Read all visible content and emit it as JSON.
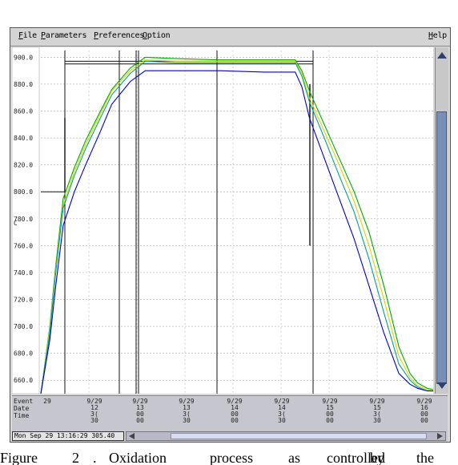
{
  "menu": {
    "file": "File",
    "parameters": "Parameters",
    "preferences": "Preferences",
    "option": "Option",
    "help": "Help"
  },
  "chart_data": {
    "type": "line",
    "ylabel": "C",
    "ylim": [
      650,
      905
    ],
    "y_ticks": [
      "900.0",
      "880.0",
      "860.0",
      "840.0",
      "820.0",
      "800.0",
      "780.0",
      "760.0",
      "740.0",
      "720.0",
      "700.0",
      "680.0",
      "660.0"
    ],
    "xlim": [
      0,
      526
    ],
    "series": [
      {
        "color": "#00a800",
        "x": [
          0,
          12,
          20,
          30,
          45,
          60,
          80,
          95,
          120,
          140,
          180,
          240,
          300,
          330,
          341,
          350,
          360,
          380,
          400,
          420,
          440,
          460,
          480,
          495,
          505,
          518,
          526
        ],
        "values": [
          650,
          700,
          745,
          795,
          818,
          838,
          860,
          876,
          892,
          900,
          899,
          898,
          898,
          898,
          898,
          890,
          875,
          850,
          825,
          800,
          770,
          730,
          685,
          665,
          658,
          654,
          653
        ]
      },
      {
        "color": "#e0d000",
        "x": [
          0,
          12,
          20,
          30,
          45,
          60,
          80,
          95,
          120,
          140,
          180,
          240,
          300,
          330,
          341,
          350,
          360,
          380,
          400,
          420,
          440,
          460,
          480,
          495,
          505,
          518,
          526
        ],
        "values": [
          650,
          698,
          742,
          790,
          815,
          835,
          858,
          875,
          890,
          898,
          897,
          897,
          897,
          897,
          897,
          888,
          870,
          845,
          820,
          793,
          760,
          720,
          678,
          662,
          656,
          653,
          652
        ]
      },
      {
        "color": "#00a0a0",
        "x": [
          0,
          12,
          20,
          30,
          45,
          60,
          80,
          95,
          120,
          140,
          180,
          240,
          300,
          330,
          341,
          350,
          360,
          380,
          400,
          420,
          440,
          460,
          480,
          495,
          505,
          518,
          526
        ],
        "values": [
          650,
          695,
          740,
          788,
          812,
          832,
          855,
          872,
          888,
          897,
          896,
          896,
          896,
          896,
          896,
          886,
          867,
          840,
          812,
          785,
          750,
          710,
          672,
          660,
          655,
          652,
          652
        ]
      },
      {
        "color": "#0000c8",
        "x": [
          0,
          12,
          20,
          30,
          45,
          60,
          80,
          95,
          120,
          140,
          180,
          240,
          300,
          330,
          341,
          350,
          360,
          380,
          400,
          420,
          440,
          460,
          480,
          495,
          505,
          518,
          526
        ],
        "values": [
          650,
          690,
          730,
          775,
          800,
          820,
          845,
          865,
          882,
          890,
          890,
          890,
          889,
          889,
          889,
          878,
          855,
          825,
          795,
          765,
          730,
          695,
          665,
          657,
          654,
          652,
          652
        ]
      }
    ]
  },
  "events": {
    "labels": [
      "Event",
      "Date",
      "Time"
    ],
    "columns": [
      {
        "lines": [
          "29",
          "",
          ""
        ]
      },
      {
        "lines": [
          "9/29",
          "12",
          "3(",
          "30"
        ]
      },
      {
        "lines": [
          "9/29",
          "13",
          "00",
          "00"
        ]
      },
      {
        "lines": [
          "9/29",
          "13",
          "3(",
          "30"
        ]
      },
      {
        "lines": [
          "9/29",
          "14",
          "00",
          "00"
        ]
      },
      {
        "lines": [
          "9/29",
          "14",
          "3(",
          "30"
        ]
      },
      {
        "lines": [
          "9/29",
          "15",
          "00",
          "00"
        ]
      },
      {
        "lines": [
          "9/29",
          "15",
          "3(",
          "30"
        ]
      },
      {
        "lines": [
          "9/29",
          "16",
          "00",
          "00"
        ]
      }
    ]
  },
  "status": {
    "text": "Mon Sep 29 13:16:29 305.40"
  },
  "caption": {
    "words": [
      "Figure",
      "2",
      ".",
      "Oxidation",
      "process",
      "as",
      "controlled",
      "by",
      "the"
    ]
  },
  "colors": {
    "window_bg": "#d9d9d9",
    "event_panel": "#c6c6ce",
    "scroll_thumb": "#7890b8"
  }
}
